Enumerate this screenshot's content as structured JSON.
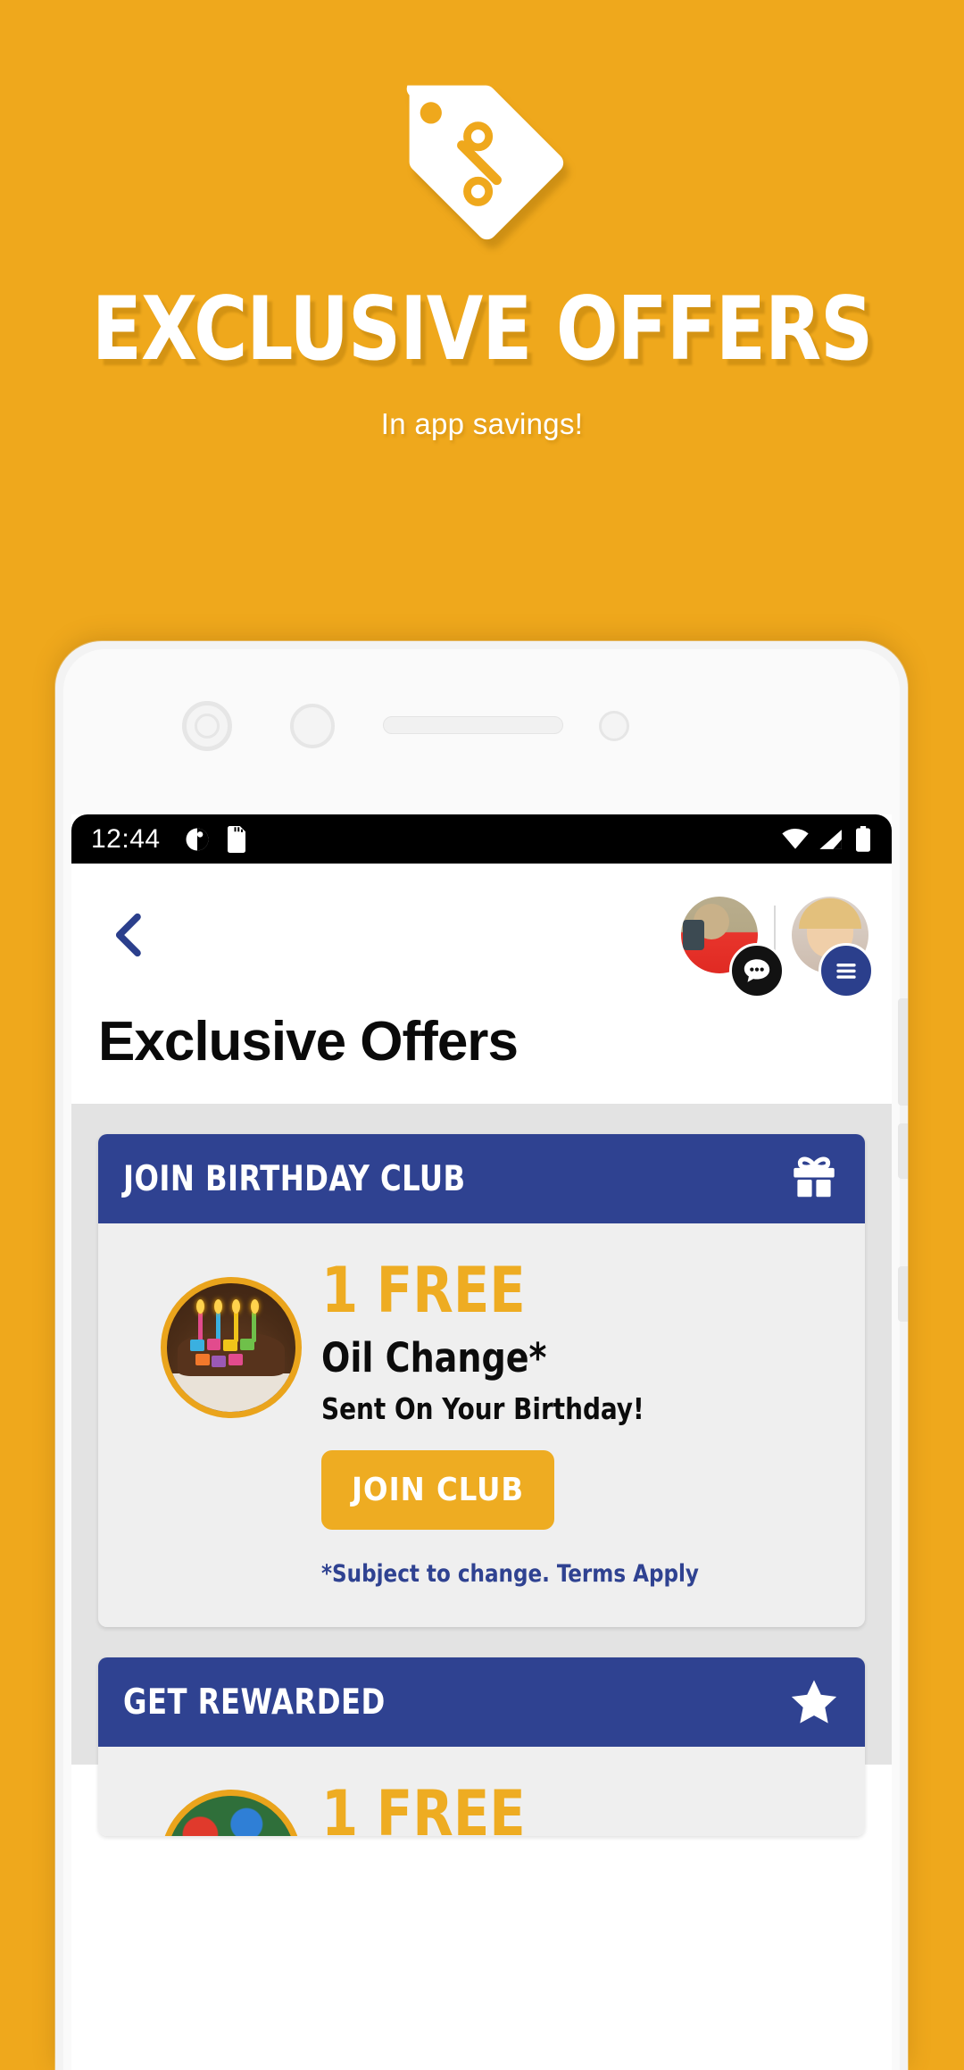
{
  "promo": {
    "icon": "price-tags-icon",
    "title": "EXCLUSIVE OFFERS",
    "subtitle": "In app savings!",
    "background_color": "#efa81c",
    "text_color": "#ffffff"
  },
  "phone": {
    "statusbar": {
      "time": "12:44",
      "left_icons": [
        "dnd-icon",
        "sd-card-icon"
      ],
      "right_icons": [
        "wifi-icon",
        "signal-icon",
        "battery-icon"
      ],
      "background_color": "#000000",
      "text_color": "#ffffff"
    },
    "navbar": {
      "back_icon": "chevron-left-icon",
      "back_color": "#2b3f8c",
      "avatars": [
        {
          "name": "avatar-technician",
          "badge": "chat-icon"
        },
        {
          "name": "avatar-user",
          "badge": "menu-icon"
        }
      ]
    },
    "page_title": "Exclusive Offers",
    "cards": [
      {
        "header_title": "JOIN BIRTHDAY CLUB",
        "header_icon": "gift-icon",
        "header_color": "#2f4291",
        "thumb": "birthday-cake-image",
        "headline": "1 FREE",
        "headline_color": "#eeac22",
        "main_text": "Oil Change*",
        "note_text": "Sent On Your Birthday!",
        "button_label": "JOIN CLUB",
        "button_color": "#eeac22",
        "terms": "*Subject to change. Terms Apply",
        "terms_color": "#2f4291"
      },
      {
        "header_title": "GET REWARDED",
        "header_icon": "star-icon",
        "header_color": "#2f4291",
        "thumb": "candy-image",
        "headline": "1 FREE"
      }
    ]
  }
}
